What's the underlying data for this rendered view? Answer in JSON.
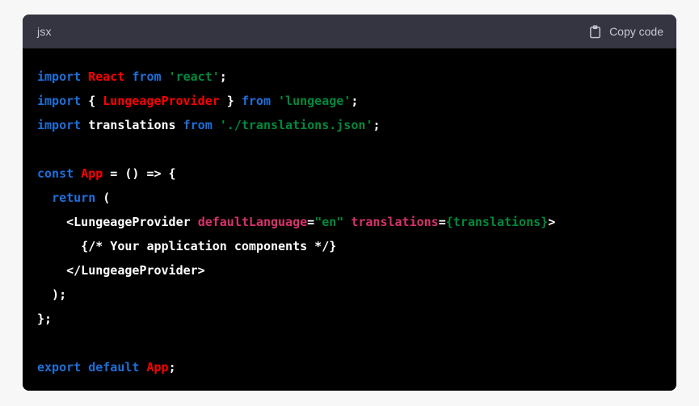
{
  "card": {
    "language_label": "jsx",
    "copy_button_label": "Copy code",
    "copy_icon": "clipboard-icon",
    "header_bg": "#343541",
    "code_bg": "#000000",
    "page_bg": "#f7f7f8"
  },
  "theme": {
    "keyword": "#1e6fd9",
    "identifier": "#ff0000",
    "string": "#008a3c",
    "attribute": "#d6336c",
    "plain": "#ffffff",
    "expression": "#008a3c"
  },
  "code": {
    "language": "jsx",
    "lines": [
      [
        {
          "t": "import",
          "c": "kw"
        },
        {
          "t": " ",
          "c": "plain"
        },
        {
          "t": "React",
          "c": "id"
        },
        {
          "t": " ",
          "c": "plain"
        },
        {
          "t": "from",
          "c": "kw"
        },
        {
          "t": " ",
          "c": "plain"
        },
        {
          "t": "'react'",
          "c": "str"
        },
        {
          "t": ";",
          "c": "plain"
        }
      ],
      [
        {
          "t": "import",
          "c": "kw"
        },
        {
          "t": " { ",
          "c": "plain"
        },
        {
          "t": "LungeageProvider",
          "c": "id"
        },
        {
          "t": " } ",
          "c": "plain"
        },
        {
          "t": "from",
          "c": "kw"
        },
        {
          "t": " ",
          "c": "plain"
        },
        {
          "t": "'lungeage'",
          "c": "str"
        },
        {
          "t": ";",
          "c": "plain"
        }
      ],
      [
        {
          "t": "import",
          "c": "kw"
        },
        {
          "t": " translations ",
          "c": "plain"
        },
        {
          "t": "from",
          "c": "kw"
        },
        {
          "t": " ",
          "c": "plain"
        },
        {
          "t": "'./translations.json'",
          "c": "str"
        },
        {
          "t": ";",
          "c": "plain"
        }
      ],
      [],
      [
        {
          "t": "const",
          "c": "kw"
        },
        {
          "t": " ",
          "c": "plain"
        },
        {
          "t": "App",
          "c": "id"
        },
        {
          "t": " = () => {",
          "c": "plain"
        }
      ],
      [
        {
          "t": "  ",
          "c": "plain"
        },
        {
          "t": "return",
          "c": "kw"
        },
        {
          "t": " (",
          "c": "plain"
        }
      ],
      [
        {
          "t": "    <LungeageProvider ",
          "c": "plain"
        },
        {
          "t": "defaultLanguage",
          "c": "attr"
        },
        {
          "t": "=",
          "c": "plain"
        },
        {
          "t": "\"en\"",
          "c": "str"
        },
        {
          "t": " ",
          "c": "plain"
        },
        {
          "t": "translations",
          "c": "attr"
        },
        {
          "t": "=",
          "c": "plain"
        },
        {
          "t": "{translations}",
          "c": "expr"
        },
        {
          "t": ">",
          "c": "plain"
        }
      ],
      [
        {
          "t": "      {/* Your application components */}",
          "c": "plain"
        }
      ],
      [
        {
          "t": "    </LungeageProvider>",
          "c": "plain"
        }
      ],
      [
        {
          "t": "  );",
          "c": "plain"
        }
      ],
      [
        {
          "t": "};",
          "c": "plain"
        }
      ],
      [],
      [
        {
          "t": "export",
          "c": "kw"
        },
        {
          "t": " ",
          "c": "plain"
        },
        {
          "t": "default",
          "c": "kw"
        },
        {
          "t": " ",
          "c": "plain"
        },
        {
          "t": "App",
          "c": "id"
        },
        {
          "t": ";",
          "c": "plain"
        }
      ]
    ]
  }
}
